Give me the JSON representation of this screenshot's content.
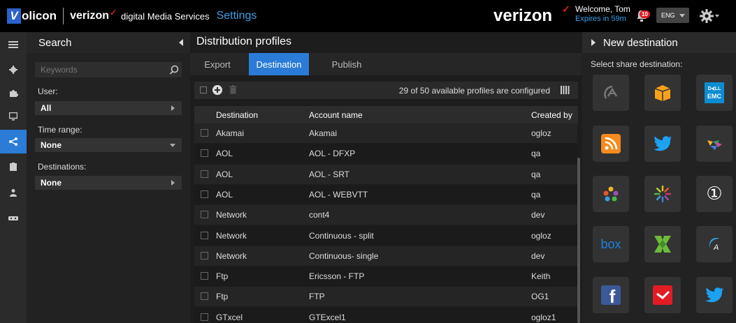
{
  "header": {
    "logo_letter": "V",
    "logo_rest": "olicon",
    "brand_small": "verizon",
    "brand_small_check": "✓",
    "brand_suffix": "digital Media Services",
    "app_title": "Settings",
    "brand_big": "verizon",
    "brand_big_check": "✓",
    "welcome": "Welcome, Tom",
    "expires": "Expires in 59m",
    "notifications_count": "10",
    "language": "ENG"
  },
  "rail": {
    "icons": [
      "menu-icon",
      "gear-icon",
      "puzzle-icon",
      "monitor-icon",
      "share-icon",
      "clipboard-icon",
      "user-icon",
      "ticket-icon"
    ],
    "active_index": 4
  },
  "search": {
    "title": "Search",
    "keywords_placeholder": "Keywords",
    "user_label": "User:",
    "user_value": "All",
    "time_label": "Time range:",
    "time_value": "None",
    "destinations_label": "Destinations:",
    "destinations_value": "None"
  },
  "main": {
    "title": "Distribution profiles",
    "tabs": [
      {
        "label": "Export",
        "active": false
      },
      {
        "label": "Destination",
        "active": true
      },
      {
        "label": "Publish",
        "active": false
      }
    ],
    "count_text": "29 of 50 available profiles are configured",
    "columns": [
      "Destination",
      "Account name",
      "Created by"
    ],
    "rows": [
      {
        "destination": "Akamai",
        "account": "Akamai",
        "created_by": "ogloz"
      },
      {
        "destination": "AOL",
        "account": "AOL - DFXP",
        "created_by": "qa"
      },
      {
        "destination": "AOL",
        "account": "AOL - SRT",
        "created_by": "qa"
      },
      {
        "destination": "AOL",
        "account": "AOL - WEBVTT",
        "created_by": "qa"
      },
      {
        "destination": "Network",
        "account": "cont4",
        "created_by": "dev"
      },
      {
        "destination": "Network",
        "account": "Continuous - split",
        "created_by": "ogloz"
      },
      {
        "destination": "Network",
        "account": "Continuous- single",
        "created_by": "dev"
      },
      {
        "destination": "Ftp",
        "account": "Ericsson - FTP",
        "created_by": "Keith"
      },
      {
        "destination": "Ftp",
        "account": "FTP",
        "created_by": "OG1"
      },
      {
        "destination": "GTxcel",
        "account": "GTExcel1",
        "created_by": "ogloz1"
      }
    ]
  },
  "destination_panel": {
    "title": "New destination",
    "subtitle": "Select share destination:",
    "tiles": [
      {
        "name": "akamai-logo-icon"
      },
      {
        "name": "amazon-box-icon"
      },
      {
        "name": "dell-emc-logo-icon",
        "text": "DELL EMC"
      },
      {
        "name": "rss-icon"
      },
      {
        "name": "twitter-icon"
      },
      {
        "name": "pinwheel-logo-icon"
      },
      {
        "name": "dots-logo-icon"
      },
      {
        "name": "starburst-logo-icon"
      },
      {
        "name": "circled-one-icon",
        "text": "①"
      },
      {
        "name": "box-logo-icon",
        "text": "box"
      },
      {
        "name": "green-x-logo-icon"
      },
      {
        "name": "wave-a-logo-icon"
      },
      {
        "name": "facebook-icon",
        "text": "f"
      },
      {
        "name": "red-check-icon"
      },
      {
        "name": "twitter-icon-2"
      }
    ]
  }
}
